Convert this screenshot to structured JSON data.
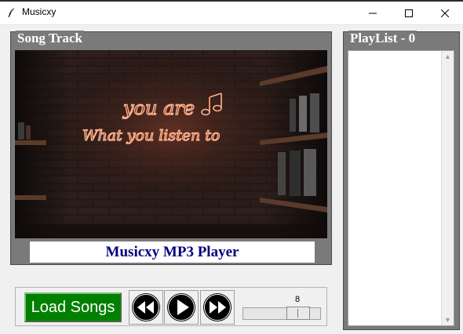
{
  "window": {
    "title": "Musicxy",
    "icons": {
      "app": "feather-icon",
      "minimize": "minimize-icon",
      "maximize": "maximize-icon",
      "close": "close-icon"
    }
  },
  "song_track": {
    "title": "Song Track",
    "artwork_text_line1": "you are",
    "artwork_text_line2": "What you listen to",
    "caption": "Musicxy MP3 Player"
  },
  "playlist": {
    "title": "PlayList - 0",
    "items": []
  },
  "controls": {
    "load_label": "Load Songs",
    "rewind_icon": "rewind-icon",
    "play_icon": "play-icon",
    "fast_forward_icon": "fast-forward-icon",
    "volume": {
      "value": "8",
      "min": 0,
      "max": 10
    }
  },
  "colors": {
    "frame": "#7a7a7a",
    "caption_text": "#000080",
    "load_button": "#008000",
    "neon": "#ff8a5c"
  }
}
